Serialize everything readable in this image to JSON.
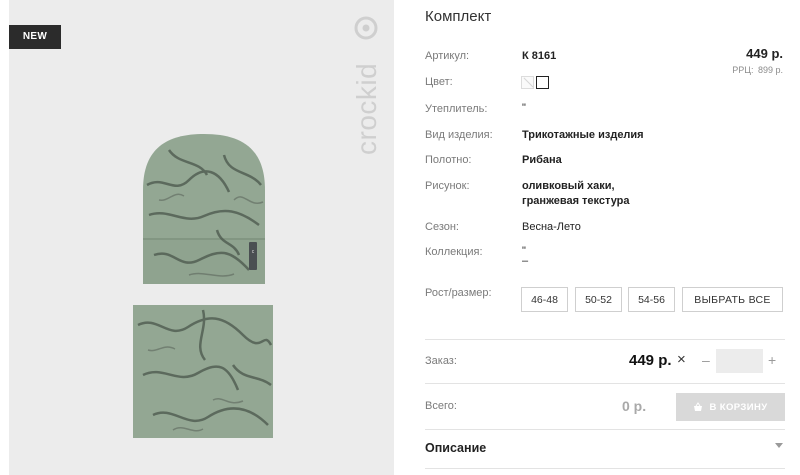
{
  "gallery": {
    "badge": "NEW",
    "brand": "crockid"
  },
  "product": {
    "title": "Комплект",
    "price": "449 р.",
    "rrp_label": "РРЦ:",
    "rrp_value": "899 р."
  },
  "attributes": [
    {
      "label": "Артикул:",
      "value": "К 8161"
    },
    {
      "label": "Цвет:",
      "value": ""
    },
    {
      "label": "Утеплитель:",
      "value": "\""
    },
    {
      "label": "Вид изделия:",
      "value": "Трикотажные изделия"
    },
    {
      "label": "Полотно:",
      "value": "Рибана"
    },
    {
      "label": "Рисунок:",
      "value": "оливковый хаки,",
      "value2": "гранжевая текстура"
    },
    {
      "label": "Сезон:",
      "value": "Весна-Лето"
    },
    {
      "label": "Коллекция:",
      "value": "\"",
      "value2": "–"
    }
  ],
  "colors": [
    {
      "name": "pattern-swatch",
      "color": "#fafafa"
    },
    {
      "name": "plain-swatch",
      "color": "#ffffff"
    }
  ],
  "sizes": {
    "label": "Рост/размер:",
    "options": [
      "46-48",
      "50-52",
      "54-56"
    ],
    "select_all": "ВЫБРАТЬ ВСЕ"
  },
  "order": {
    "label": "Заказ:",
    "price": "449 р.",
    "times": "×",
    "minus": "–",
    "quantity": "",
    "plus": "+"
  },
  "total": {
    "label": "Всего:",
    "value": "0 р.",
    "cart_button": "В КОРЗИНУ"
  },
  "description": {
    "title": "Описание"
  },
  "theme": {
    "fabric_color": "#93a793",
    "fabric_dark": "#4a554b"
  }
}
